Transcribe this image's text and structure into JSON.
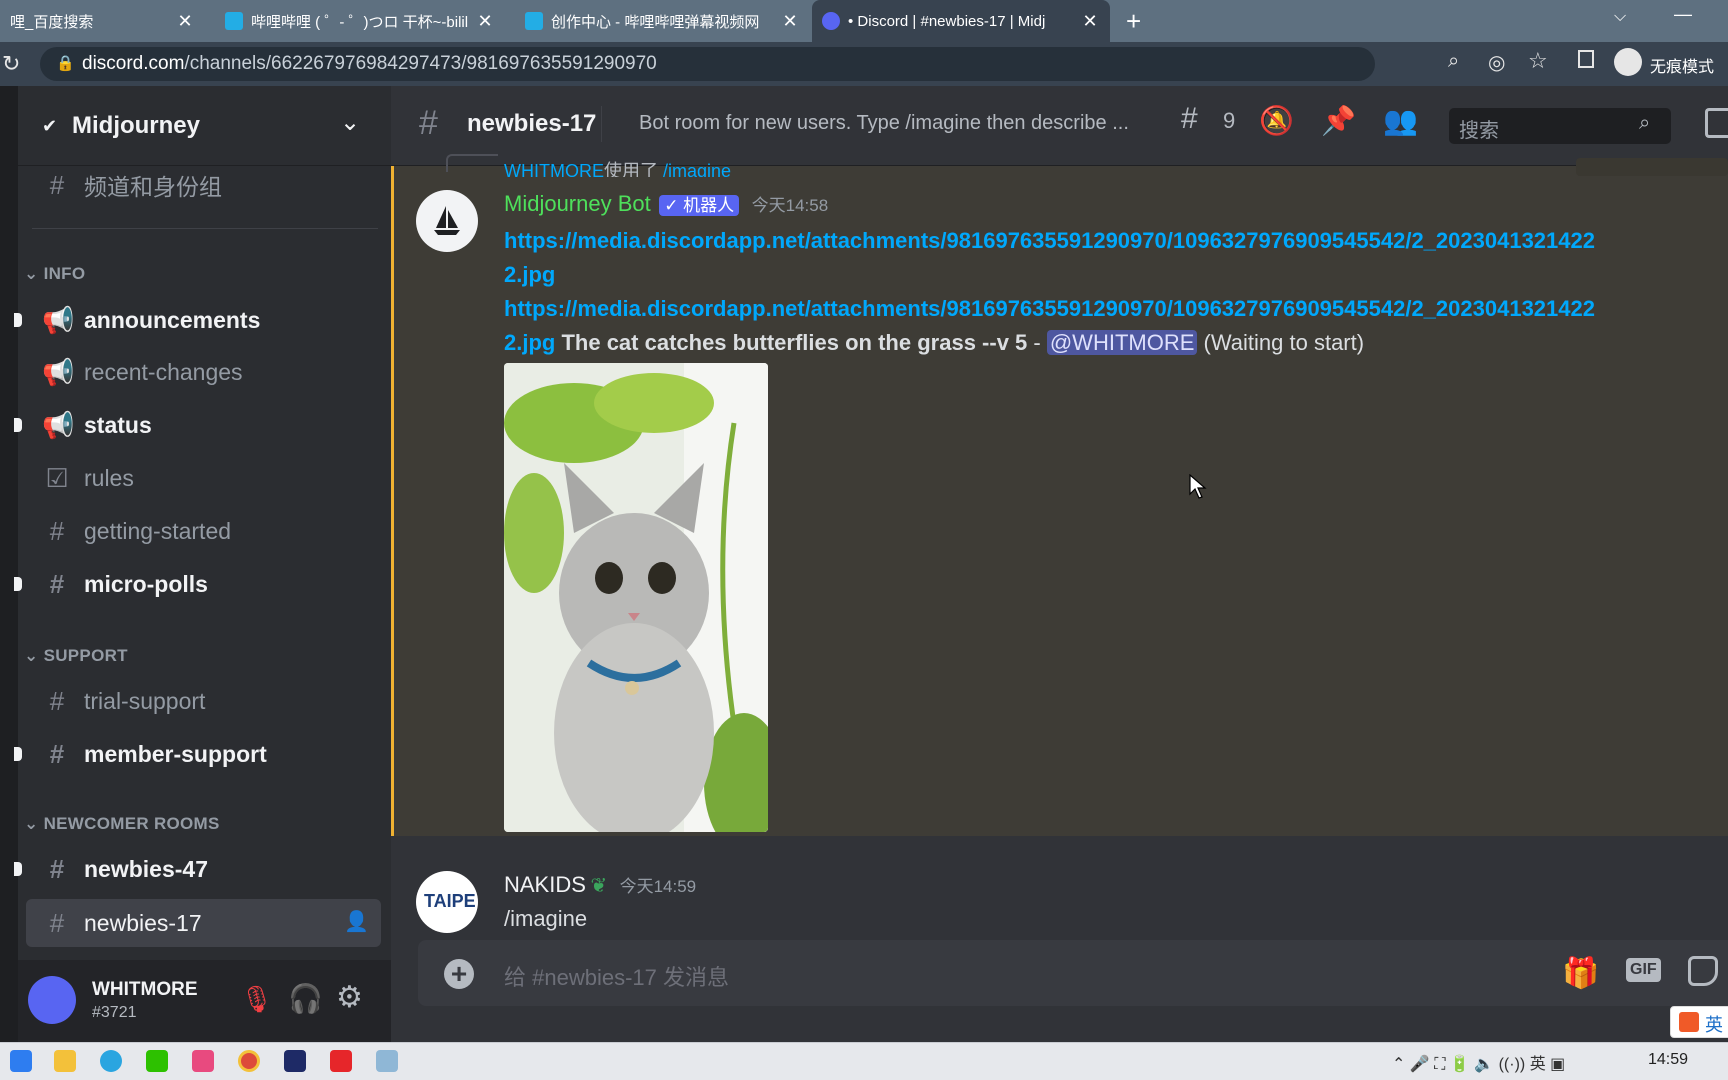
{
  "browser": {
    "tabs": [
      {
        "title": "哩_百度搜索",
        "active": false
      },
      {
        "title": "哔哩哔哩 ( ゜- ゜)つロ 干杯~-bilil",
        "active": false
      },
      {
        "title": "创作中心 - 哔哩哔哩弹幕视频网",
        "active": false
      },
      {
        "title": "• Discord | #newbies-17 | Midj",
        "active": true
      }
    ],
    "url_domain": "discord.com",
    "url_path": "/channels/662267976984297473/981697635591290970",
    "incognito_label": "无痕模式"
  },
  "server": {
    "name": "Midjourney"
  },
  "sidebar": {
    "roles_item": "频道和身份组",
    "categories": {
      "info": "INFO",
      "support": "SUPPORT",
      "newcomer": "NEWCOMER ROOMS"
    },
    "channels": {
      "announcements": "announcements",
      "recent_changes": "recent-changes",
      "status": "status",
      "rules": "rules",
      "getting_started": "getting-started",
      "micro_polls": "micro-polls",
      "trial_support": "trial-support",
      "member_support": "member-support",
      "newbies_47": "newbies-47",
      "newbies_17": "newbies-17"
    }
  },
  "user": {
    "name": "WHITMORE",
    "tag": "#3721"
  },
  "header": {
    "channel": "newbies-17",
    "topic": "Bot room for new users. Type /imagine then describe ...",
    "threads_count": "9",
    "search_placeholder": "搜索"
  },
  "messages": {
    "reply_ref": {
      "user": "WHITMORE",
      "used": "使用了",
      "cmd": "/imagine"
    },
    "bot": {
      "author": "Midjourney Bot",
      "badge": "✓ 机器人",
      "time": "今天14:58",
      "link1_a": "https://media.discordapp.net/attachments/981697635591290970/1096327976909545542/2_2023041321422",
      "link1_b": "2.jpg",
      "link2_a": "https://media.discordapp.net/attachments/981697635591290970/1096327976909545542/2_2023041321422",
      "link2_b": "2.jpg",
      "prompt": "The cat catches butterflies on the grass --v 5",
      "dash": " - ",
      "mention": "@WHITMORE",
      "status": "(Waiting to start)"
    },
    "user_msg": {
      "author": "NAKIDS",
      "time": "今天14:59",
      "text": "/imagine",
      "avatar_text": "TAIPE"
    }
  },
  "composer": {
    "placeholder": "给 #newbies-17 发消息",
    "gif_label": "GIF"
  },
  "taskbar": {
    "time": "14:59",
    "ime": "英"
  },
  "colors": {
    "accent": "#5865f2",
    "bot_name": "#4ee05b",
    "link": "#00a8fc",
    "mention_bar": "#f0b232"
  }
}
